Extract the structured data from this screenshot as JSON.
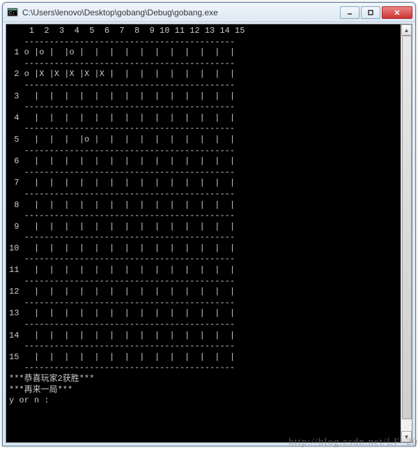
{
  "window": {
    "title": "C:\\Users\\lenovo\\Desktop\\gobang\\Debug\\gobang.exe"
  },
  "board": {
    "cols": 15,
    "rows": 15,
    "pieces": [
      {
        "r": 1,
        "c": 1,
        "sym": "o"
      },
      {
        "r": 1,
        "c": 2,
        "sym": "o"
      },
      {
        "r": 1,
        "c": 4,
        "sym": "o"
      },
      {
        "r": 2,
        "c": 1,
        "sym": "o"
      },
      {
        "r": 2,
        "c": 2,
        "sym": "X"
      },
      {
        "r": 2,
        "c": 3,
        "sym": "X"
      },
      {
        "r": 2,
        "c": 4,
        "sym": "X"
      },
      {
        "r": 2,
        "c": 5,
        "sym": "X"
      },
      {
        "r": 2,
        "c": 6,
        "sym": "X"
      },
      {
        "r": 5,
        "c": 5,
        "sym": "o"
      }
    ]
  },
  "messages": {
    "win": "***恭喜玩家2获胜***",
    "again": "***再来一局***",
    "prompt": "y or n :"
  },
  "watermark": "http://blog.csdn.net/LF_20"
}
